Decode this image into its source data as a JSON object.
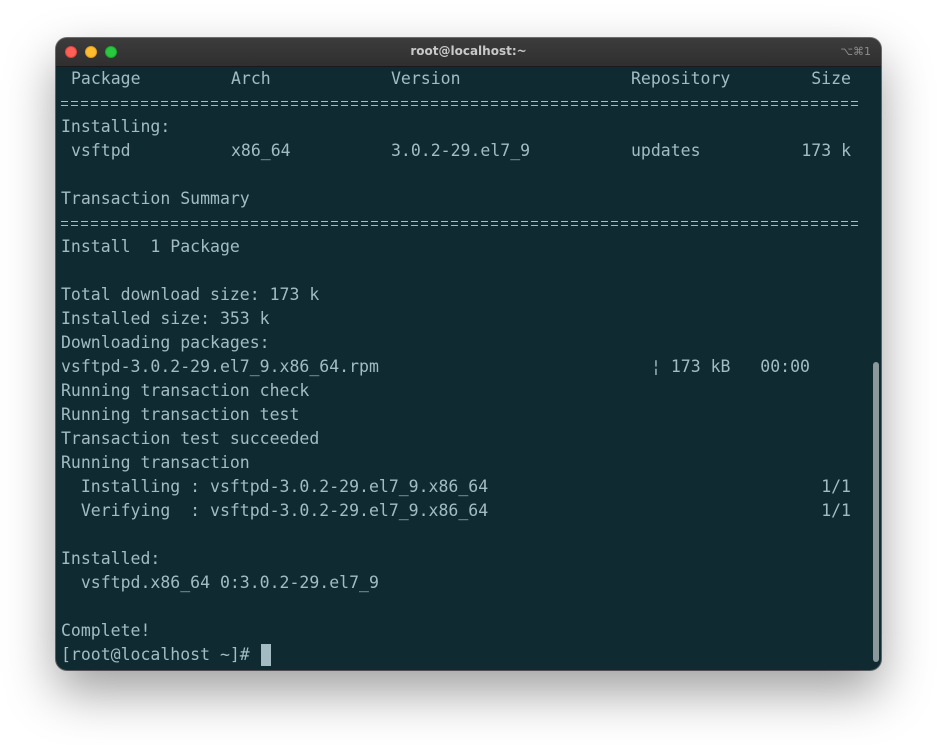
{
  "window": {
    "title": "root@localhost:~",
    "shortcut": "⌥⌘1"
  },
  "table": {
    "headers": {
      "package": "Package",
      "arch": "Arch",
      "version": "Version",
      "repository": "Repository",
      "size": "Size"
    },
    "section_label": "Installing:",
    "row": {
      "package": "vsftpd",
      "arch": "x86_64",
      "version": "3.0.2-29.el7_9",
      "repository": "updates",
      "size": "173 k"
    }
  },
  "summary": {
    "title": "Transaction Summary",
    "install_count": "Install  1 Package"
  },
  "sizes": {
    "total_download": "Total download size: 173 k",
    "installed": "Installed size: 353 k"
  },
  "download": {
    "label": "Downloading packages:",
    "file": "vsftpd-3.0.2-29.el7_9.x86_64.rpm",
    "progress": "¦ 173 kB   00:00"
  },
  "transaction": {
    "check": "Running transaction check",
    "test": "Running transaction test",
    "test_ok": "Transaction test succeeded",
    "running": "Running transaction",
    "installing": "  Installing : vsftpd-3.0.2-29.el7_9.x86_64",
    "installing_count": "1/1",
    "verifying": "  Verifying  : vsftpd-3.0.2-29.el7_9.x86_64",
    "verifying_count": "1/1"
  },
  "installed": {
    "label": "Installed:",
    "package": "  vsftpd.x86_64 0:3.0.2-29.el7_9"
  },
  "complete": "Complete!",
  "prompt": "[root@localhost ~]#",
  "colors": {
    "background": "#0f2b31",
    "foreground": "#a3bcc3",
    "titlebar": "#353535"
  }
}
